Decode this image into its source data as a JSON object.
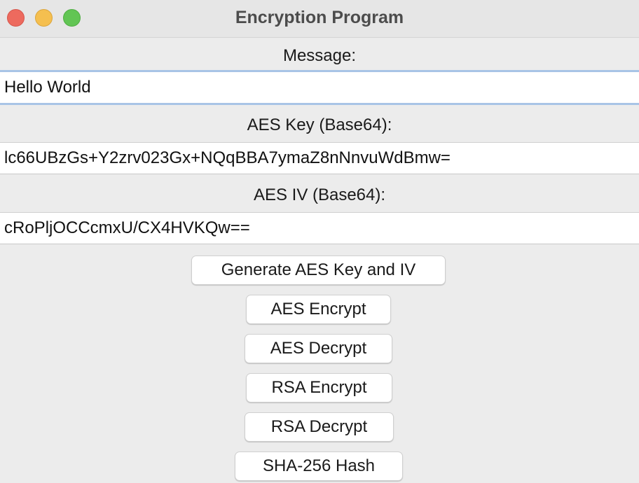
{
  "window": {
    "title": "Encryption Program"
  },
  "form": {
    "message_label": "Message:",
    "message_value": "Hello World",
    "aes_key_label": "AES Key (Base64):",
    "aes_key_value": "lc66UBzGs+Y2zrv023Gx+NQqBBA7ymaZ8nNnvuWdBmw=",
    "aes_iv_label": "AES IV (Base64):",
    "aes_iv_value": "cRoPljOCCcmxU/CX4HVKQw=="
  },
  "buttons": {
    "generate": "Generate AES Key and IV",
    "aes_encrypt": "AES Encrypt",
    "aes_decrypt": "AES Decrypt",
    "rsa_encrypt": "RSA Encrypt",
    "rsa_decrypt": "RSA Decrypt",
    "sha256": "SHA-256 Hash"
  },
  "colors": {
    "close": "#ed6a5e",
    "minimize": "#f5bf4f",
    "maximize": "#62c554",
    "focus_ring": "#a8c4e6"
  },
  "icons": {
    "close": "close-icon",
    "minimize": "minimize-icon",
    "maximize": "maximize-icon"
  }
}
